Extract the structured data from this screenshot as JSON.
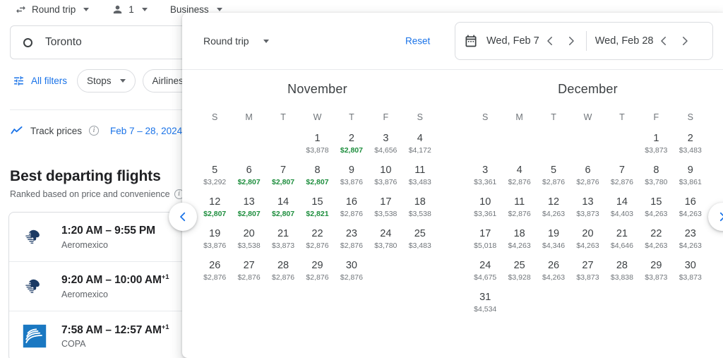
{
  "toolbar": {
    "trip_type": "Round trip",
    "passengers": "1",
    "cabin_class": "Business",
    "swap_icon": "swap-horizontal-icon",
    "person_icon": "person-icon"
  },
  "search": {
    "origin_value": "Toronto",
    "origin_icon": "circle-origin-icon"
  },
  "filters": {
    "all_filters_label": "All filters",
    "all_filters_icon": "tune-icon",
    "chips": [
      {
        "label": "Stops"
      },
      {
        "label": "Airlines"
      }
    ]
  },
  "track": {
    "label": "Track prices",
    "trend_icon": "trending-up-icon",
    "info_icon": "info-icon",
    "info_glyph": "i",
    "dates": "Feb 7 – 28, 2024"
  },
  "results": {
    "heading": "Best departing flights",
    "subheading": "Ranked based on price and convenience",
    "subheading_info_icon": "info-icon",
    "flights": [
      {
        "time": "1:20 AM – 9:55 PM",
        "day_offset": "",
        "airline": "Aeromexico",
        "logo": "aeromexico-logo"
      },
      {
        "time": "9:20 AM – 10:00 AM",
        "day_offset": "+1",
        "airline": "Aeromexico",
        "logo": "aeromexico-logo"
      },
      {
        "time": "7:58 AM – 12:57 AM",
        "day_offset": "+1",
        "airline": "COPA",
        "logo": "copa-logo"
      }
    ]
  },
  "calendar": {
    "trip_type": "Round trip",
    "reset_label": "Reset",
    "calendar_icon": "calendar-icon",
    "departure_date": "Wed, Feb 7",
    "return_date": "Wed, Feb 28",
    "prev_icon": "chevron-left-icon",
    "next_icon": "chevron-right-icon",
    "page_prev_icon": "chevron-left-icon",
    "page_next_icon": "chevron-right-icon",
    "low_price_color": "#1e8e3e",
    "accent_color": "#1a73e8",
    "weekdays": [
      "S",
      "M",
      "T",
      "W",
      "T",
      "F",
      "S"
    ],
    "months": [
      {
        "name": "November",
        "lead_blanks": 3,
        "days": [
          {
            "n": "1",
            "price": "$3,878",
            "low": false
          },
          {
            "n": "2",
            "price": "$2,807",
            "low": true
          },
          {
            "n": "3",
            "price": "$4,656",
            "low": false
          },
          {
            "n": "4",
            "price": "$4,172",
            "low": false
          },
          {
            "n": "5",
            "price": "$3,292",
            "low": false
          },
          {
            "n": "6",
            "price": "$2,807",
            "low": true
          },
          {
            "n": "7",
            "price": "$2,807",
            "low": true
          },
          {
            "n": "8",
            "price": "$2,807",
            "low": true
          },
          {
            "n": "9",
            "price": "$3,876",
            "low": false
          },
          {
            "n": "10",
            "price": "$3,876",
            "low": false
          },
          {
            "n": "11",
            "price": "$3,483",
            "low": false
          },
          {
            "n": "12",
            "price": "$2,807",
            "low": true
          },
          {
            "n": "13",
            "price": "$2,807",
            "low": true
          },
          {
            "n": "14",
            "price": "$2,807",
            "low": true
          },
          {
            "n": "15",
            "price": "$2,821",
            "low": true
          },
          {
            "n": "16",
            "price": "$2,876",
            "low": false
          },
          {
            "n": "17",
            "price": "$3,538",
            "low": false
          },
          {
            "n": "18",
            "price": "$3,538",
            "low": false
          },
          {
            "n": "19",
            "price": "$3,876",
            "low": false
          },
          {
            "n": "20",
            "price": "$3,538",
            "low": false
          },
          {
            "n": "21",
            "price": "$3,873",
            "low": false
          },
          {
            "n": "22",
            "price": "$2,876",
            "low": false
          },
          {
            "n": "23",
            "price": "$2,876",
            "low": false
          },
          {
            "n": "24",
            "price": "$3,780",
            "low": false
          },
          {
            "n": "25",
            "price": "$3,483",
            "low": false
          },
          {
            "n": "26",
            "price": "$2,876",
            "low": false
          },
          {
            "n": "27",
            "price": "$2,876",
            "low": false
          },
          {
            "n": "28",
            "price": "$2,876",
            "low": false
          },
          {
            "n": "29",
            "price": "$2,876",
            "low": false
          },
          {
            "n": "30",
            "price": "$2,876",
            "low": false
          }
        ]
      },
      {
        "name": "December",
        "lead_blanks": 5,
        "days": [
          {
            "n": "1",
            "price": "$3,873",
            "low": false
          },
          {
            "n": "2",
            "price": "$3,483",
            "low": false
          },
          {
            "n": "3",
            "price": "$3,361",
            "low": false
          },
          {
            "n": "4",
            "price": "$2,876",
            "low": false
          },
          {
            "n": "5",
            "price": "$2,876",
            "low": false
          },
          {
            "n": "6",
            "price": "$2,876",
            "low": false
          },
          {
            "n": "7",
            "price": "$2,876",
            "low": false
          },
          {
            "n": "8",
            "price": "$3,780",
            "low": false
          },
          {
            "n": "9",
            "price": "$3,861",
            "low": false
          },
          {
            "n": "10",
            "price": "$3,361",
            "low": false
          },
          {
            "n": "11",
            "price": "$2,876",
            "low": false
          },
          {
            "n": "12",
            "price": "$4,263",
            "low": false
          },
          {
            "n": "13",
            "price": "$3,873",
            "low": false
          },
          {
            "n": "14",
            "price": "$4,403",
            "low": false
          },
          {
            "n": "15",
            "price": "$4,263",
            "low": false
          },
          {
            "n": "16",
            "price": "$4,263",
            "low": false
          },
          {
            "n": "17",
            "price": "$5,018",
            "low": false
          },
          {
            "n": "18",
            "price": "$4,263",
            "low": false
          },
          {
            "n": "19",
            "price": "$4,346",
            "low": false
          },
          {
            "n": "20",
            "price": "$4,263",
            "low": false
          },
          {
            "n": "21",
            "price": "$4,646",
            "low": false
          },
          {
            "n": "22",
            "price": "$4,263",
            "low": false
          },
          {
            "n": "23",
            "price": "$4,263",
            "low": false
          },
          {
            "n": "24",
            "price": "$4,675",
            "low": false
          },
          {
            "n": "25",
            "price": "$3,928",
            "low": false
          },
          {
            "n": "26",
            "price": "$4,263",
            "low": false
          },
          {
            "n": "27",
            "price": "$3,873",
            "low": false
          },
          {
            "n": "28",
            "price": "$3,838",
            "low": false
          },
          {
            "n": "29",
            "price": "$3,873",
            "low": false
          },
          {
            "n": "30",
            "price": "$3,873",
            "low": false
          },
          {
            "n": "31",
            "price": "$4,534",
            "low": false
          }
        ]
      }
    ]
  }
}
